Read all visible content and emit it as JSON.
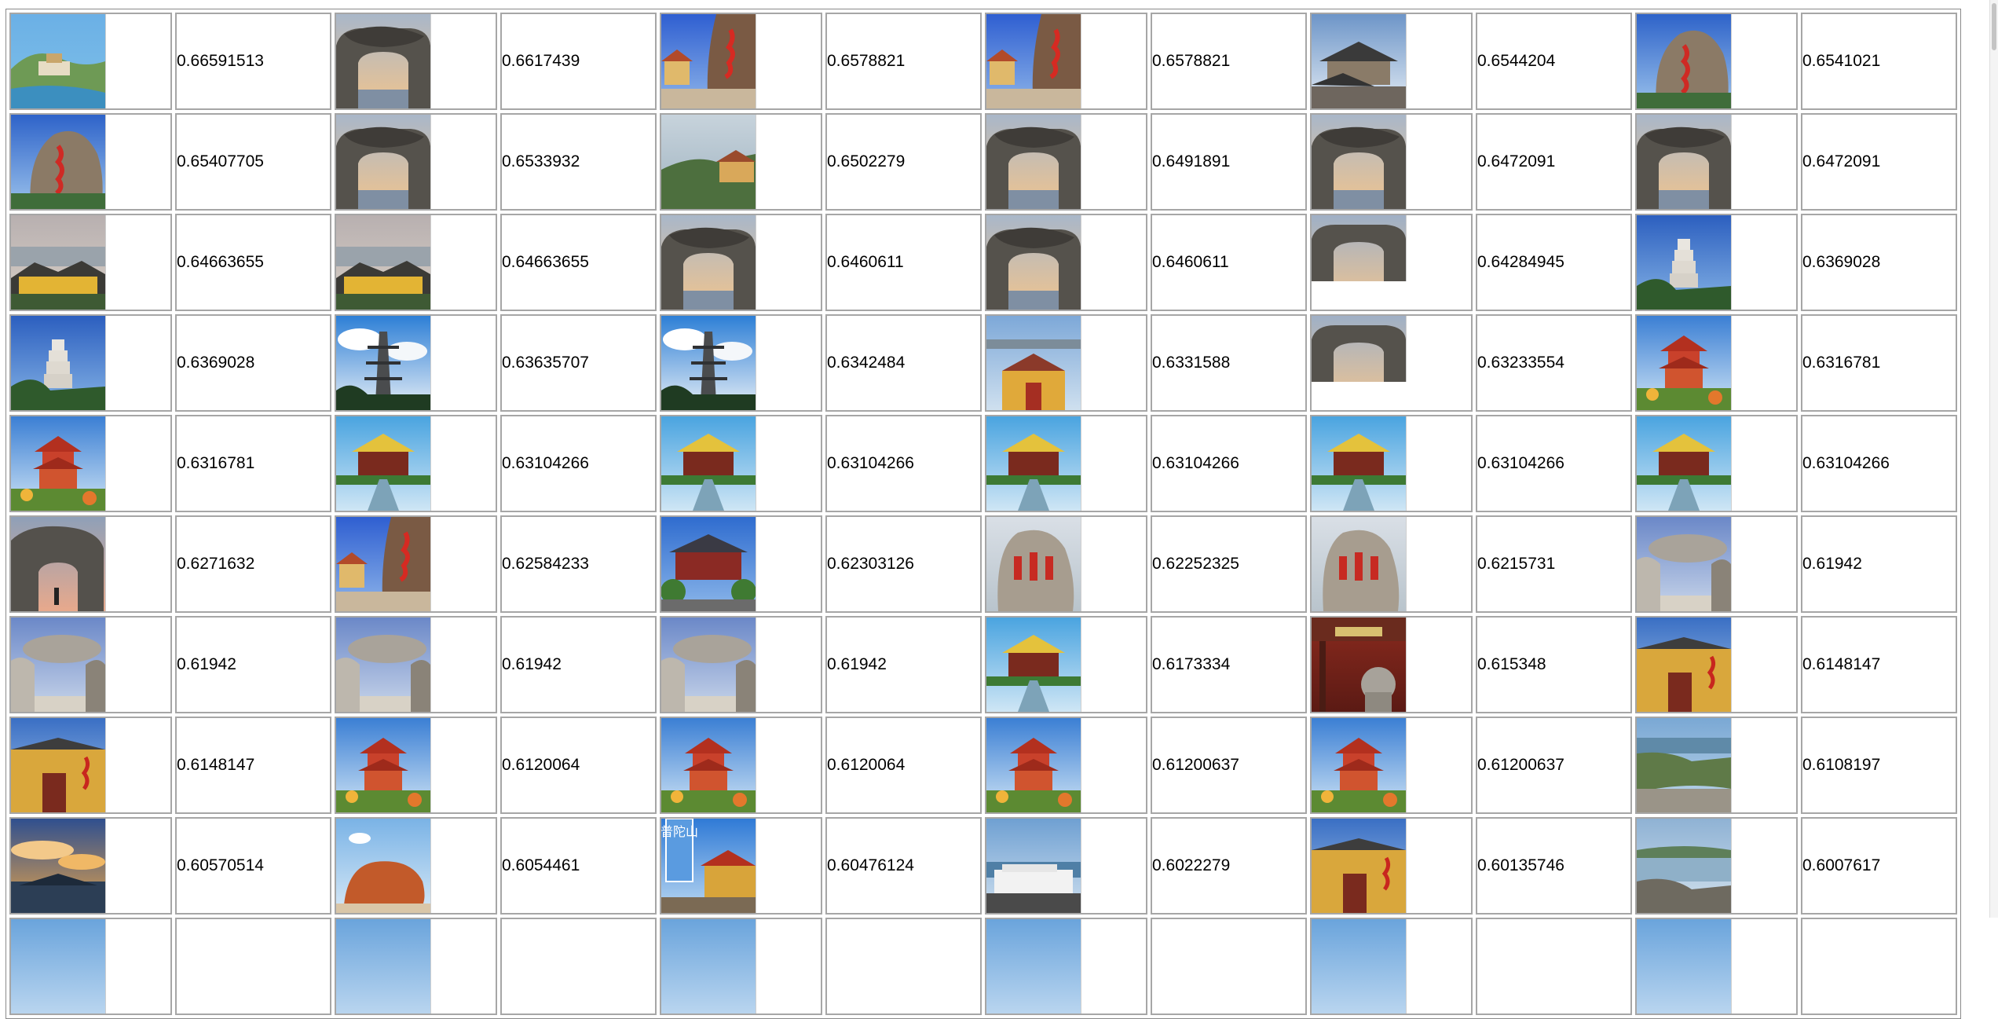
{
  "rows": [
    {
      "cells": [
        {
          "image": "island-aerial-view",
          "score": "0.66591513"
        },
        {
          "image": "stone-arch-sunset",
          "score": "0.6617439"
        },
        {
          "image": "temple-red-rock-carving",
          "score": "0.6578821"
        },
        {
          "image": "temple-red-rock-carving",
          "score": "0.6578821"
        },
        {
          "image": "temple-roofs-cloudy-sky",
          "score": "0.6544204"
        },
        {
          "image": "red-calligraphy-rock",
          "score": "0.6541021"
        }
      ]
    },
    {
      "cells": [
        {
          "image": "red-calligraphy-rock",
          "score": "0.65407705"
        },
        {
          "image": "stone-arch-sunset",
          "score": "0.6533932"
        },
        {
          "image": "coastal-temple-cliff",
          "score": "0.6502279"
        },
        {
          "image": "stone-arch-sunset",
          "score": "0.6491891"
        },
        {
          "image": "stone-arch-sunset",
          "score": "0.6472091"
        },
        {
          "image": "stone-arch-sunset",
          "score": "0.6472091"
        }
      ]
    },
    {
      "cells": [
        {
          "image": "yellow-temple-seaside",
          "score": "0.64663655"
        },
        {
          "image": "yellow-temple-seaside",
          "score": "0.64663655"
        },
        {
          "image": "stone-arch-sunset",
          "score": "0.6460611"
        },
        {
          "image": "stone-arch-sunset",
          "score": "0.6460611"
        },
        {
          "image": "stone-arch-sunset-small",
          "score": "0.64284945"
        },
        {
          "image": "white-pagoda-blue-sky",
          "score": "0.6369028"
        }
      ]
    },
    {
      "cells": [
        {
          "image": "white-pagoda-blue-sky",
          "score": "0.6369028"
        },
        {
          "image": "stone-pagoda-clouds",
          "score": "0.63635707"
        },
        {
          "image": "stone-pagoda-clouds",
          "score": "0.6342484"
        },
        {
          "image": "yellow-temple-complex",
          "score": "0.6331588"
        },
        {
          "image": "stone-arch-sunset-small",
          "score": "0.63233554"
        },
        {
          "image": "red-pavilion-flowers",
          "score": "0.6316781"
        }
      ]
    },
    {
      "cells": [
        {
          "image": "red-pavilion-flowers",
          "score": "0.6316781"
        },
        {
          "image": "temple-gate-bridge",
          "score": "0.63104266"
        },
        {
          "image": "temple-gate-bridge",
          "score": "0.63104266"
        },
        {
          "image": "temple-gate-bridge",
          "score": "0.63104266"
        },
        {
          "image": "temple-gate-bridge",
          "score": "0.63104266"
        },
        {
          "image": "temple-gate-bridge",
          "score": "0.63104266"
        }
      ]
    },
    {
      "cells": [
        {
          "image": "stone-arch-person",
          "score": "0.6271632"
        },
        {
          "image": "temple-red-rock-carving",
          "score": "0.62584233"
        },
        {
          "image": "temple-hall-trees",
          "score": "0.62303126"
        },
        {
          "image": "carved-stone-red-text",
          "score": "0.62252325"
        },
        {
          "image": "carved-stone-red-text",
          "score": "0.6215731"
        },
        {
          "image": "balanced-rock-arch",
          "score": "0.61942"
        }
      ]
    },
    {
      "cells": [
        {
          "image": "balanced-rock-arch",
          "score": "0.61942"
        },
        {
          "image": "balanced-rock-arch",
          "score": "0.61942"
        },
        {
          "image": "balanced-rock-arch",
          "score": "0.61942"
        },
        {
          "image": "temple-gate-bridge",
          "score": "0.6173334"
        },
        {
          "image": "temple-gate-lion-statue",
          "score": "0.615348"
        },
        {
          "image": "yellow-temple-wall",
          "score": "0.6148147"
        }
      ]
    },
    {
      "cells": [
        {
          "image": "yellow-temple-wall",
          "score": "0.6148147"
        },
        {
          "image": "red-pavilion-flowers",
          "score": "0.6120064"
        },
        {
          "image": "red-pavilion-flowers",
          "score": "0.6120064"
        },
        {
          "image": "red-pavilion-flowers",
          "score": "0.61200637"
        },
        {
          "image": "red-pavilion-flowers",
          "score": "0.61200637"
        },
        {
          "image": "coastal-village-aerial",
          "score": "0.6108197"
        }
      ]
    },
    {
      "cells": [
        {
          "image": "island-sunset-clouds",
          "score": "0.60570514"
        },
        {
          "image": "orange-rock-formation",
          "score": "0.6054461"
        },
        {
          "image": "temple-calligraphy-banner",
          "score": "0.60476124"
        },
        {
          "image": "ferry-boat-harbor",
          "score": "0.6022279"
        },
        {
          "image": "yellow-temple-wall",
          "score": "0.60135746"
        },
        {
          "image": "rocky-coast-village",
          "score": "0.6007617"
        }
      ]
    },
    {
      "cells": [
        {
          "image": "partial-row-image",
          "score": ""
        },
        {
          "image": "partial-row-image",
          "score": ""
        },
        {
          "image": "partial-row-image",
          "score": ""
        },
        {
          "image": "partial-row-image",
          "score": ""
        },
        {
          "image": "partial-row-image",
          "score": ""
        },
        {
          "image": "partial-row-image",
          "score": ""
        }
      ]
    }
  ],
  "banner_text": "普陀山"
}
